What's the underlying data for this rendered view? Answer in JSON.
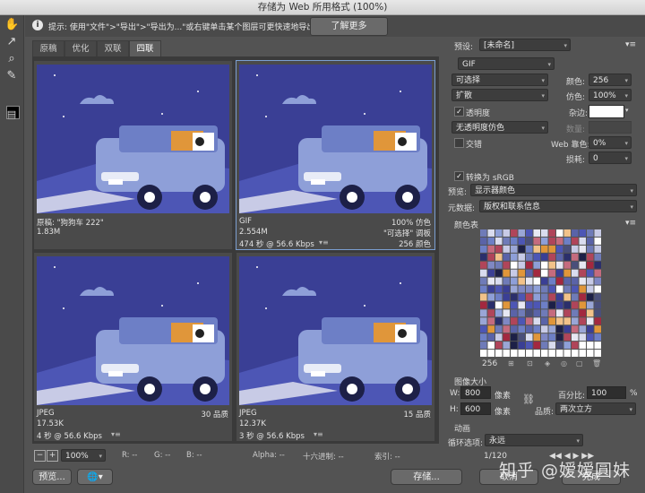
{
  "window": {
    "title": "存储为 Web 所用格式 (100%)"
  },
  "infobar": {
    "text": "提示: 使用\"文件\">\"导出\">\"导出为...\"或右键单击某个图层可更快速地导出资源",
    "learn_more": "了解更多"
  },
  "tools": [
    "hand-icon",
    "slice-select-icon",
    "zoom-icon",
    "eyedropper-icon",
    "eyedropper-color-swatch",
    "toggle-slices-icon"
  ],
  "tabs": [
    {
      "label": "原稿"
    },
    {
      "label": "优化"
    },
    {
      "label": "双联"
    },
    {
      "label": "四联",
      "active": true
    }
  ],
  "panels": [
    {
      "line1_left": "原稿: \"狗狗车 222\"",
      "line2_left": "1.83M",
      "line3_left": "",
      "right1": "",
      "right2": "",
      "right3": ""
    },
    {
      "line1_left": "GIF",
      "line2_left": "2.554M",
      "line3_left": "474 秒 @ 56.6 Kbps",
      "right1": "100% 仿色",
      "right2": "\"可选择\" 调板",
      "right3": "256 颜色"
    },
    {
      "line1_left": "JPEG",
      "line2_left": "17.53K",
      "line3_left": "4 秒 @ 56.6 Kbps",
      "right1": "30 品质",
      "right2": "",
      "right3": ""
    },
    {
      "line1_left": "JPEG",
      "line2_left": "12.37K",
      "line3_left": "3 秒 @ 56.6 Kbps",
      "right1": "15 品质",
      "right2": "",
      "right3": ""
    }
  ],
  "statusbar": {
    "zoom": "100%",
    "r": "R: --",
    "g": "G: --",
    "b": "B: --",
    "alpha": "Alpha: --",
    "hex": "十六进制: --",
    "index": "索引: --"
  },
  "bottom": {
    "preview": "预览...",
    "save": "存储...",
    "cancel": "取消",
    "done": "完成"
  },
  "settings": {
    "preset_label": "预设:",
    "preset_value": "[未命名]",
    "format": "GIF",
    "reduction": "可选择",
    "colors_label": "颜色:",
    "colors_value": "256",
    "dither_algo": "扩散",
    "dither_label": "仿色:",
    "dither_value": "100%",
    "transparency_label": "透明度",
    "transparency_checked": true,
    "matte_label": "杂边:",
    "trans_dither": "无透明度仿色",
    "amount_label": "数量:",
    "interlaced_label": "交错",
    "interlaced_checked": false,
    "websnap_label": "Web 靠色:",
    "websnap_value": "0%",
    "lossy_label": "损耗:",
    "lossy_value": "0",
    "srgb_label": "转换为 sRGB",
    "srgb_checked": true,
    "preview_label": "预览:",
    "preview_value": "显示器颜色",
    "metadata_label": "元数据:",
    "metadata_value": "版权和联系信息",
    "colortable_label": "颜色表",
    "color_count": "256",
    "imagesize_label": "图像大小",
    "w_label": "W:",
    "w_value": "800",
    "px_label": "像素",
    "h_label": "H:",
    "h_value": "600",
    "percent_label": "百分比:",
    "percent_value": "100",
    "percent_unit": "%",
    "quality_label": "品质:",
    "quality_value": "两次立方",
    "animation_label": "动画",
    "loop_label": "循环选项:",
    "loop_value": "永远",
    "frame_counter": "1/120"
  },
  "watermark": "知乎 @嫒嫒圓妹",
  "colors": {
    "sky": "#3a3f95",
    "hill": "#4d56b5",
    "car": "#8e9fd8",
    "car_dark": "#6d7fc6",
    "orange": "#e0963a",
    "accent_blue": "#7b9fd1"
  }
}
